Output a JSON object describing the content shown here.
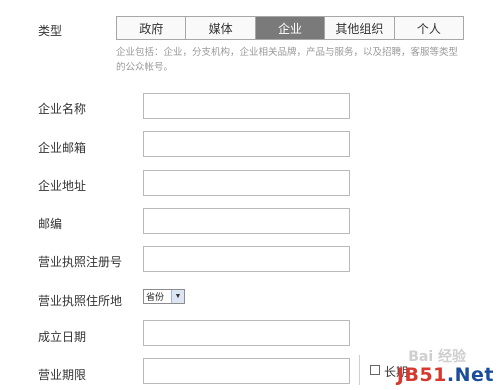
{
  "type_row": {
    "label": "类型",
    "tabs": [
      {
        "label": "政府",
        "active": false
      },
      {
        "label": "媒体",
        "active": false
      },
      {
        "label": "企业",
        "active": true
      },
      {
        "label": "其他组织",
        "active": false
      },
      {
        "label": "个人",
        "active": false
      }
    ],
    "hint": "企业包括：企业，分支机构，企业相关品牌，产品与服务，以及招聘，客服等类型的公众帐号。"
  },
  "fields": {
    "name": {
      "label": "企业名称",
      "value": ""
    },
    "email": {
      "label": "企业邮箱",
      "value": ""
    },
    "address": {
      "label": "企业地址",
      "value": ""
    },
    "postcode": {
      "label": "邮编",
      "value": ""
    },
    "license_number": {
      "label": "营业执照注册号",
      "value": ""
    },
    "license_location": {
      "label": "营业执照住所地",
      "select_value": "省份"
    },
    "founded_date": {
      "label": "成立日期",
      "value": ""
    },
    "term": {
      "label": "营业期限",
      "value": "",
      "checkbox_label": "长期"
    }
  },
  "watermark": {
    "brand": "JB51",
    "suffix": ".Net",
    "baidu": "Bai 经验"
  },
  "colors": {
    "active_tab_bg": "#7a7a7a",
    "border": "#b9b9b9",
    "hint": "#9a9a9a",
    "watermark_red": "#d63a2f",
    "watermark_blue": "#1a4e9a"
  }
}
